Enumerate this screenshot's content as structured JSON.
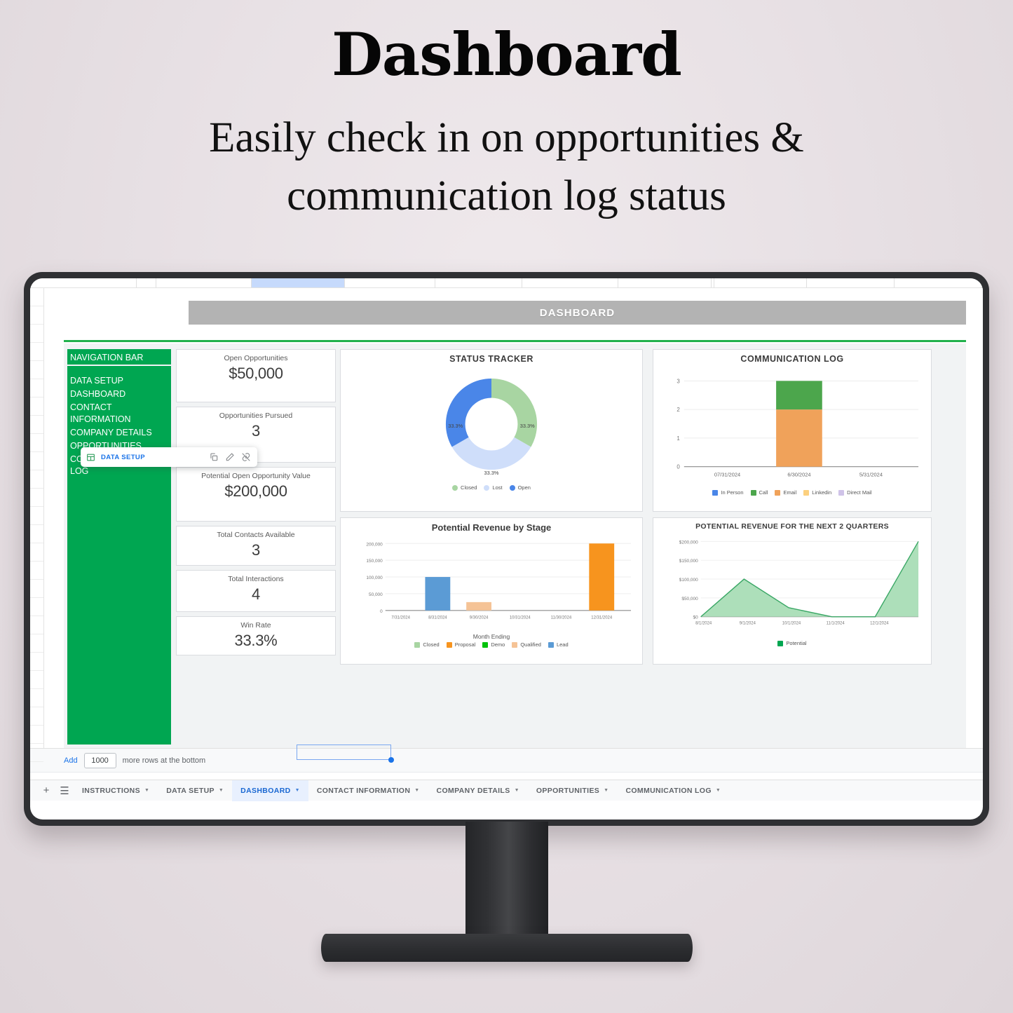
{
  "promo": {
    "title": "Dashboard",
    "subtitle": "Easily check in on opportunities & communication log status"
  },
  "sheet": {
    "title_bar": "DASHBOARD",
    "navbar": {
      "header": "NAVIGATION BAR",
      "items": [
        "DATA SETUP",
        "DASHBOARD",
        "CONTACT INFORMATION",
        "COMPANY DETAILS",
        "OPPORTUNITIES",
        "COMMUNICATIONS LOG"
      ]
    },
    "link_popup": {
      "label": "DATA SETUP",
      "icons": [
        "grid-icon",
        "copy-link-icon",
        "edit-link-icon",
        "remove-link-icon"
      ]
    },
    "kpis": [
      {
        "label": "Open Opportunities",
        "value": "$50,000"
      },
      {
        "label": "Opportunities Pursued",
        "value": "3"
      },
      {
        "label": "Potential Open Opportunity Value",
        "value": "$200,000"
      },
      {
        "label": "Total Contacts Available",
        "value": "3"
      },
      {
        "label": "Total Interactions",
        "value": "4"
      },
      {
        "label": "Win Rate",
        "value": "33.3%"
      }
    ],
    "add_rows": {
      "add_label": "Add",
      "count": "1000",
      "suffix": "more rows at the bottom"
    },
    "tabs": [
      {
        "label": "INSTRUCTIONS",
        "active": false
      },
      {
        "label": "DATA SETUP",
        "active": false
      },
      {
        "label": "DASHBOARD",
        "active": true
      },
      {
        "label": "CONTACT INFORMATION",
        "active": false
      },
      {
        "label": "COMPANY DETAILS",
        "active": false
      },
      {
        "label": "OPPORTUNITIES",
        "active": false
      },
      {
        "label": "COMMUNICATION LOG",
        "active": false
      }
    ],
    "tab_icons": [
      "add-sheet-icon",
      "all-sheets-icon"
    ]
  },
  "colors": {
    "nav_green": "#00a651",
    "accent_green": "#22b14c",
    "title_gray": "#b3b3b3",
    "tab_active_bg": "#e8f0fe",
    "tab_active_fg": "#1967d2",
    "link_blue": "#1a73e8"
  },
  "chart_data": [
    {
      "id": "status-tracker",
      "type": "pie",
      "title": "STATUS TRACKER",
      "donut": true,
      "labels": [
        "Closed",
        "Lost",
        "Open"
      ],
      "values": [
        33.3,
        33.3,
        33.3
      ],
      "value_labels": [
        "33.3%",
        "33.3%",
        "33.3%"
      ],
      "colors": [
        "#a8d5a2",
        "#cfdefa",
        "#4a86e8"
      ],
      "legend_position": "bottom"
    },
    {
      "id": "communication-log",
      "type": "bar",
      "stacked": true,
      "title": "COMMUNICATION LOG",
      "categories": [
        "07/31/2024",
        "6/30/2024",
        "5/31/2024"
      ],
      "series": [
        {
          "name": "In Person",
          "color": "#4a86e8",
          "values": [
            0,
            0,
            0
          ]
        },
        {
          "name": "Call",
          "color": "#4ca64c",
          "values": [
            0,
            1,
            0
          ]
        },
        {
          "name": "Email",
          "color": "#f0a25a",
          "values": [
            0,
            2,
            0
          ]
        },
        {
          "name": "Linkedin",
          "color": "#fcd07f",
          "values": [
            0,
            0,
            0
          ]
        },
        {
          "name": "Direct Mail",
          "color": "#cfc3e8",
          "values": [
            0,
            0,
            0
          ]
        }
      ],
      "ylim": [
        0,
        3
      ],
      "yticks": [
        "0",
        "1",
        "2",
        "3"
      ],
      "xlabel": "",
      "ylabel": "",
      "grid": true,
      "legend_position": "bottom"
    },
    {
      "id": "potential-revenue-by-stage",
      "type": "bar",
      "title": "Potential Revenue by Stage",
      "categories": [
        "7/31/2024",
        "8/31/2024",
        "9/30/2024",
        "10/31/2024",
        "11/30/2024",
        "12/31/2024"
      ],
      "values": [
        0,
        100000,
        25000,
        0,
        0,
        200000
      ],
      "bar_colors": [
        "#a8d5a2",
        "#5b9bd5",
        "#f5c396",
        "#a8d5a2",
        "#a8d5a2",
        "#f7941e"
      ],
      "ylim": [
        0,
        200000
      ],
      "yticks": [
        "0",
        "50,000",
        "100,000",
        "150,000",
        "200,000"
      ],
      "xlabel": "Month Ending",
      "ylabel": "",
      "grid": true,
      "legend": [
        {
          "name": "Closed",
          "color": "#a8d5a2"
        },
        {
          "name": "Proposal",
          "color": "#f7941e"
        },
        {
          "name": "Demo",
          "color": "#00c20a"
        },
        {
          "name": "Qualified",
          "color": "#f5c396"
        },
        {
          "name": "Lead",
          "color": "#5b9bd5"
        }
      ],
      "legend_position": "bottom"
    },
    {
      "id": "potential-revenue-next-2-quarters",
      "type": "area",
      "title": "POTENTIAL REVENUE FOR THE NEXT 2 QUARTERS",
      "x": [
        "8/1/2024",
        "9/1/2024",
        "10/1/2024",
        "11/1/2024",
        "12/1/2024"
      ],
      "series": [
        {
          "name": "Potential",
          "color": "#00a651",
          "fill": "#a9ddb6",
          "values": [
            0,
            100000,
            25000,
            0,
            0,
            200000
          ]
        }
      ],
      "ylim": [
        0,
        200000
      ],
      "yticks": [
        "$0",
        "$50,000",
        "$100,000",
        "$150,000",
        "$200,000"
      ],
      "xlabel": "",
      "ylabel": "",
      "grid": true,
      "legend_position": "bottom"
    }
  ]
}
